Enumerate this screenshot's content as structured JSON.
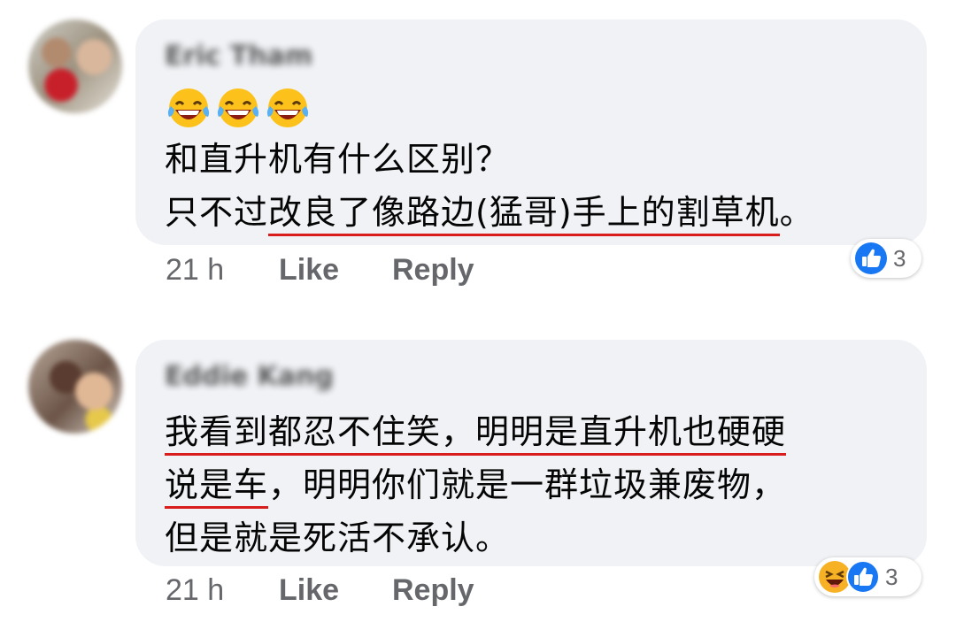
{
  "comments": [
    {
      "author": "Eric Tham",
      "emojis": [
        "laughing-tears",
        "laughing-tears",
        "laughing-tears"
      ],
      "lines": [
        {
          "pre": "和直升机有什么区别？",
          "u": "",
          "post": ""
        },
        {
          "pre": "只不过",
          "u": "改良了像路边(猛哥)手上的割草机",
          "post": "。"
        }
      ],
      "time": "21 h",
      "like_label": "Like",
      "reply_label": "Reply",
      "reactions": [
        "like"
      ],
      "reaction_count": "3"
    },
    {
      "author": "Eddie Kang",
      "emojis": [],
      "lines": [
        {
          "pre": "",
          "u": "我看到都忍不住笑，明明是直升机也硬硬",
          "post": ""
        },
        {
          "pre": "",
          "u": "说是车",
          "post": "，明明你们就是一群垃圾兼废物，"
        },
        {
          "pre": "但是就是死活不承认。",
          "u": "",
          "post": ""
        }
      ],
      "time": "21 h",
      "like_label": "Like",
      "reply_label": "Reply",
      "reactions": [
        "haha",
        "like"
      ],
      "reaction_count": "3"
    }
  ],
  "colors": {
    "bubble": "#f0f2f5",
    "action_text": "#65676b",
    "underline": "#d91c1c",
    "like_blue": "#1877f2",
    "haha_yellow": "#f7b125"
  }
}
